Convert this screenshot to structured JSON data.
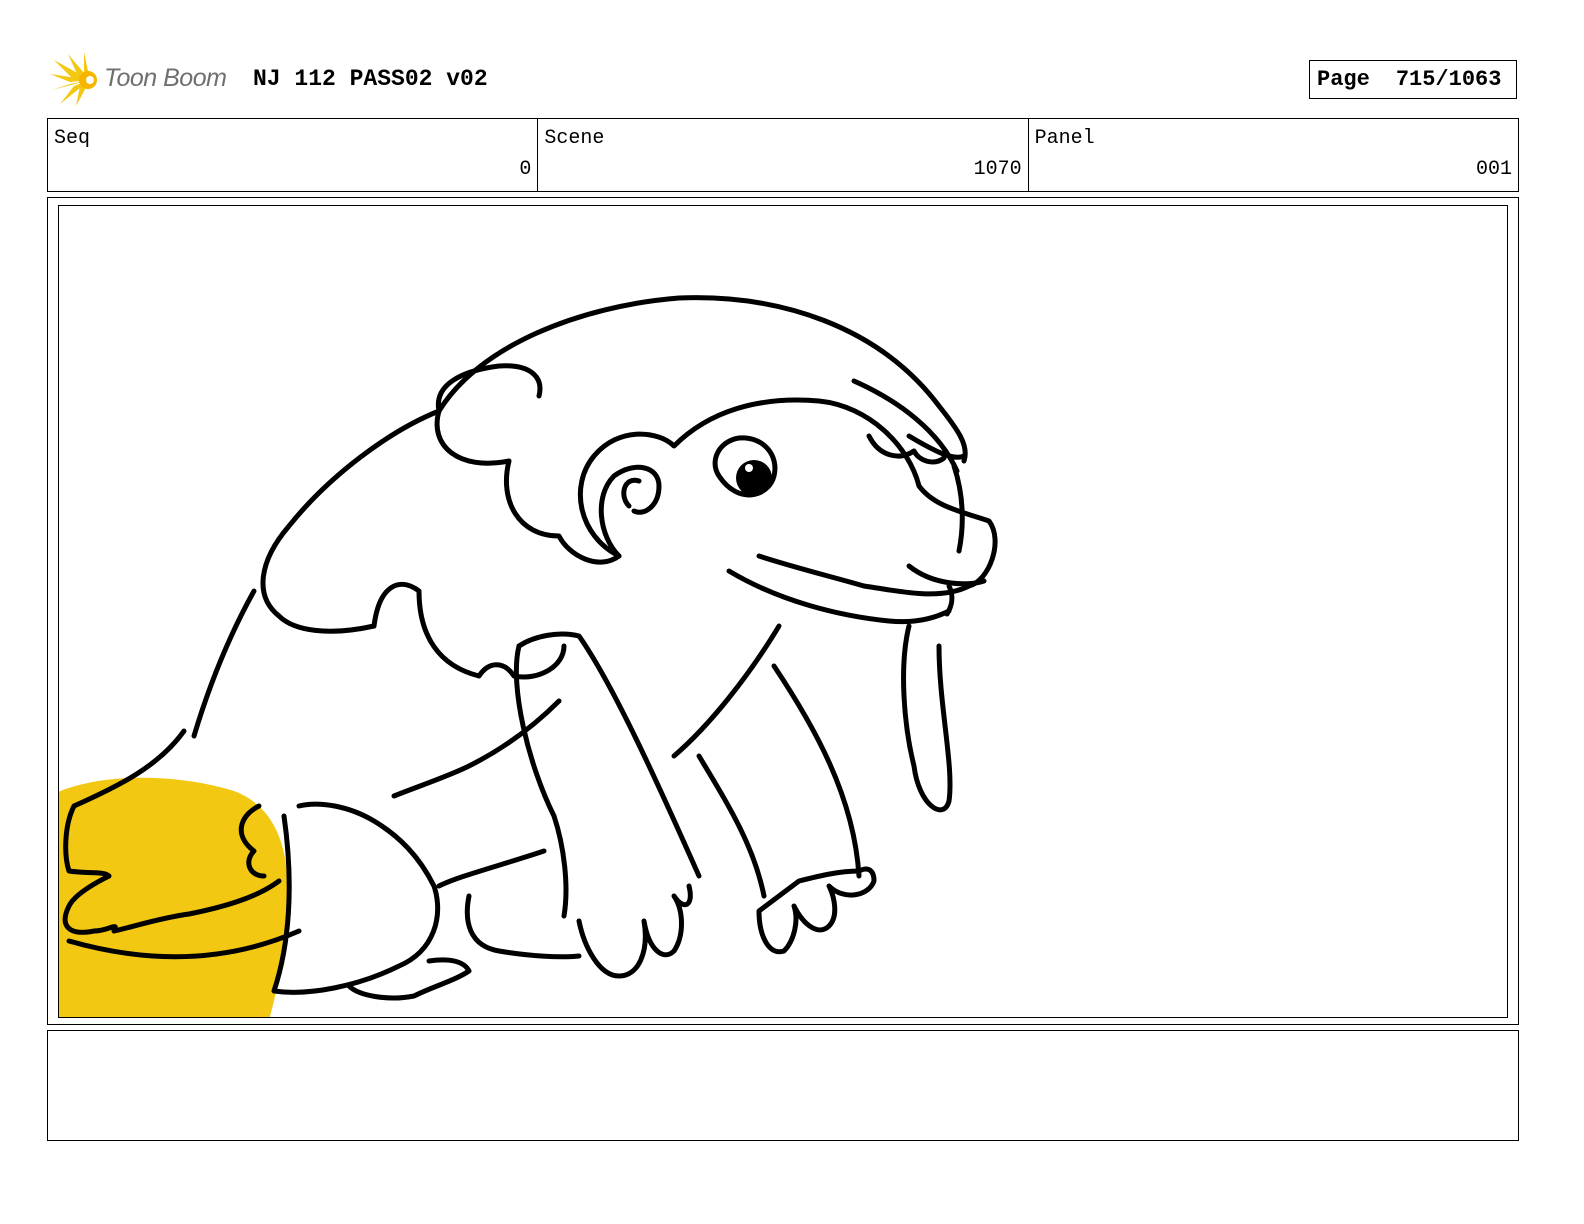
{
  "header": {
    "logo_text": "Toon Boom",
    "title": "NJ 112 PASS02 v02",
    "page_label": "Page",
    "page_number": "715/1063"
  },
  "info": {
    "seq_label": "Seq",
    "seq_value": "0",
    "scene_label": "Scene",
    "scene_value": "1070",
    "panel_label": "Panel",
    "panel_value": "001"
  },
  "panel": {
    "drawing": "creature-sketch-icon",
    "accent_color": "#f2c813"
  },
  "notes": {
    "text": ""
  }
}
